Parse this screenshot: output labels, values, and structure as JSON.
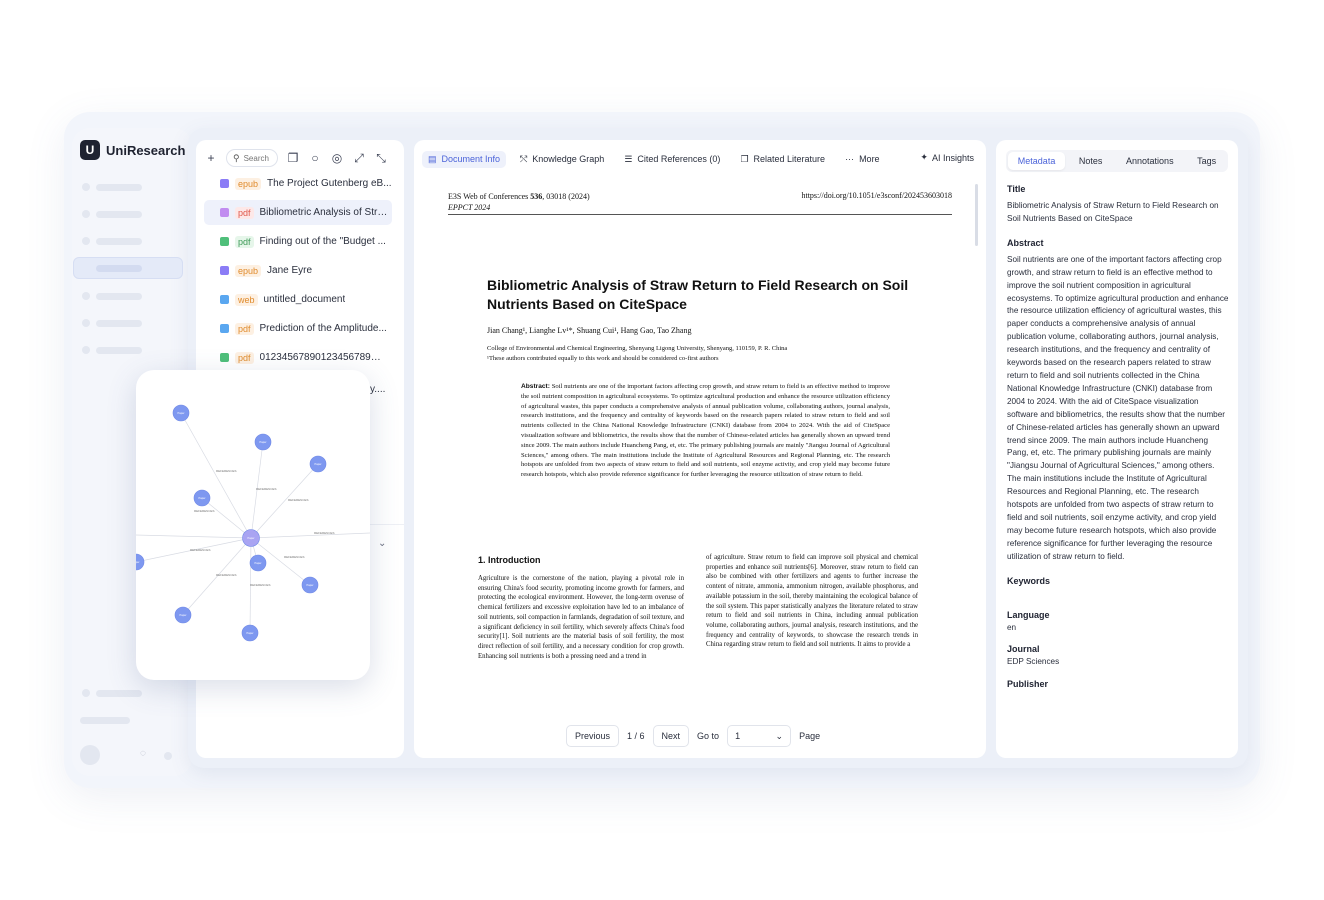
{
  "app": {
    "brand": "UniResearch",
    "logo_letter": "U"
  },
  "files": {
    "search_placeholder": "Search",
    "items": [
      {
        "type": "epub",
        "name": "The Project Gutenberg eB...",
        "color": "#8b7cf6"
      },
      {
        "type": "pdf",
        "name": "Bibliometric Analysis of Stra...",
        "color": "#c18cf0"
      },
      {
        "type": "pdf",
        "name": "Finding out of the \"Budget ...",
        "color": "#4fbf7a"
      },
      {
        "type": "epub",
        "name": "Jane Eyre",
        "color": "#8b7cf6"
      },
      {
        "type": "web",
        "name": "untitled_document",
        "color": "#5aa7f0"
      },
      {
        "type": "pdf",
        "name": "Prediction of the Amplitude...",
        "color": "#5aa7f0"
      },
      {
        "type": "pdf",
        "name": "01234567890123456789O1...",
        "color": "#4fbf7a"
      }
    ],
    "partial_label": "y...."
  },
  "graph": {
    "edge_label": "REFERENCES",
    "node_label": "Paper"
  },
  "doc": {
    "tabs": [
      {
        "label": "Document Info",
        "icon": "document-icon"
      },
      {
        "label": "Knowledge Graph",
        "icon": "graph-icon"
      },
      {
        "label": "Cited References (0)",
        "icon": "list-icon"
      },
      {
        "label": "Related Literature",
        "icon": "copy-icon"
      },
      {
        "label": "More",
        "icon": "more-icon"
      }
    ],
    "ai_insights": "AI Insights",
    "paper": {
      "header_journal": "E3S Web of Conferences ",
      "header_volume": "536",
      "header_rest": ", 03018 (2024)",
      "header_conf": "EPPCT 2024",
      "header_doi": "https://doi.org/10.1051/e3sconf/202453603018",
      "title": "Bibliometric Analysis of Straw Return to Field Research on Soil Nutrients Based on CiteSpace",
      "authors": "Jian Chang¹, Lianghe Lv¹*, Shuang Cui¹, Hang Gao, Tao Zhang",
      "affiliation": "College of Environmental and Chemical Engineering, Shenyang Ligong University, Shenyang, 110159, P. R. China",
      "note": "¹These authors contributed equally to this work and should be considered co-first authors",
      "abstract_label": "Abstract:",
      "abstract": "Soil nutrients are one of the important factors affecting crop growth, and straw return to field is an effective method to improve the soil nutrient composition in agricultural ecosystems. To optimize agricultural production and enhance the resource utilization efficiency of agricultural wastes, this paper conducts a comprehensive analysis of annual publication volume, collaborating authors, journal analysis, research institutions, and the frequency and centrality of keywords based on the research papers related to straw return to field and soil nutrients collected in the China National Knowledge Infrastructure (CNKI) database from 2004 to 2024. With the aid of CiteSpace visualization software and bibliometrics, the results show that the number of Chinese-related articles has generally shown an upward trend since 2009. The main authors include Huancheng Pang, et, etc. The primary publishing journals are mainly \"Jiangsu Journal of Agricultural Sciences,\" among others. The main institutions include the Institute of Agricultural Resources and Regional Planning, etc. The research hotspots are unfolded from two aspects of straw return to field and soil nutrients, soil enzyme activity, and crop yield may become future research hotspots, which also provide reference significance for further leveraging the resource utilization of straw return to field.",
      "section1": "1. Introduction",
      "col1": "Agriculture is the cornerstone of the nation, playing a pivotal role in ensuring China's food security, promoting income growth for farmers, and protecting the ecological environment. However, the long-term overuse of chemical fertilizers and excessive exploitation have led to an imbalance of soil nutrients, soil compaction in farmlands, degradation of soil texture, and a significant deficiency in soil fertility, which severely affects China's food security[1]. Soil nutrients are the material basis of soil fertility, the most direct reflection of soil fertility, and a necessary condition for crop growth. Enhancing soil nutrients is both a pressing need and a trend in",
      "col2": "of agriculture. Straw return to field can improve soil physical and chemical properties and enhance soil nutrients[6]. Moreover, straw return to field can also be combined with other fertilizers and agents to further increase the content of nitrate, ammonia, ammonium nitrogen, available phosphorus, and available potassium in the soil, thereby maintaining the ecological balance of the soil system. This paper statistically analyzes the literature related to straw return to field and soil nutrients in China, including annual publication volume, collaborating authors, journal analysis, research institutions, and the frequency and centrality of keywords, to showcase the research trends in China regarding straw return to field and soil nutrients. It aims to provide a"
    },
    "pager": {
      "previous": "Previous",
      "page_status": "1 / 6",
      "next": "Next",
      "goto": "Go to",
      "goto_value": "1",
      "page_word": "Page"
    }
  },
  "meta": {
    "tabs": [
      "Metadata",
      "Notes",
      "Annotations",
      "Tags"
    ],
    "title_label": "Title",
    "title": "Bibliometric Analysis of Straw Return to Field Research on Soil Nutrients Based on CiteSpace",
    "abstract_label": "Abstract",
    "abstract": "Soil nutrients are one of the important factors affecting crop growth, and straw return to field is an effective method to improve the soil nutrient composition in agricultural ecosystems. To optimize agricultural production and enhance the resource utilization efficiency of agricultural wastes, this paper conducts a comprehensive analysis of annual publication volume, collaborating authors, journal analysis, research institutions, and the frequency and centrality of keywords based on the research papers related to straw return to field and soil nutrients collected in the China National Knowledge Infrastructure (CNKI) database from 2004 to 2024. With the aid of CiteSpace visualization software and bibliometrics, the results show that the number of Chinese-related articles has generally shown an upward trend since 2009. The main authors include Huancheng Pang, et, etc. The primary publishing journals are mainly \"Jiangsu Journal of Agricultural Sciences,\" among others. The main institutions include the Institute of Agricultural Resources and Regional Planning, etc. The research hotspots are unfolded from two aspects of straw return to field and soil nutrients, soil enzyme activity, and crop yield may become future research hotspots, which also provide reference significance for further leveraging the resource utilization of straw return to field.",
    "keywords_label": "Keywords",
    "language_label": "Language",
    "language": "en",
    "journal_label": "Journal",
    "journal": "EDP Sciences",
    "publisher_label": "Publisher"
  },
  "colors": {
    "accent": "#4b63d9",
    "node": "#7e98f0",
    "node_center": "#a9a4f2"
  }
}
